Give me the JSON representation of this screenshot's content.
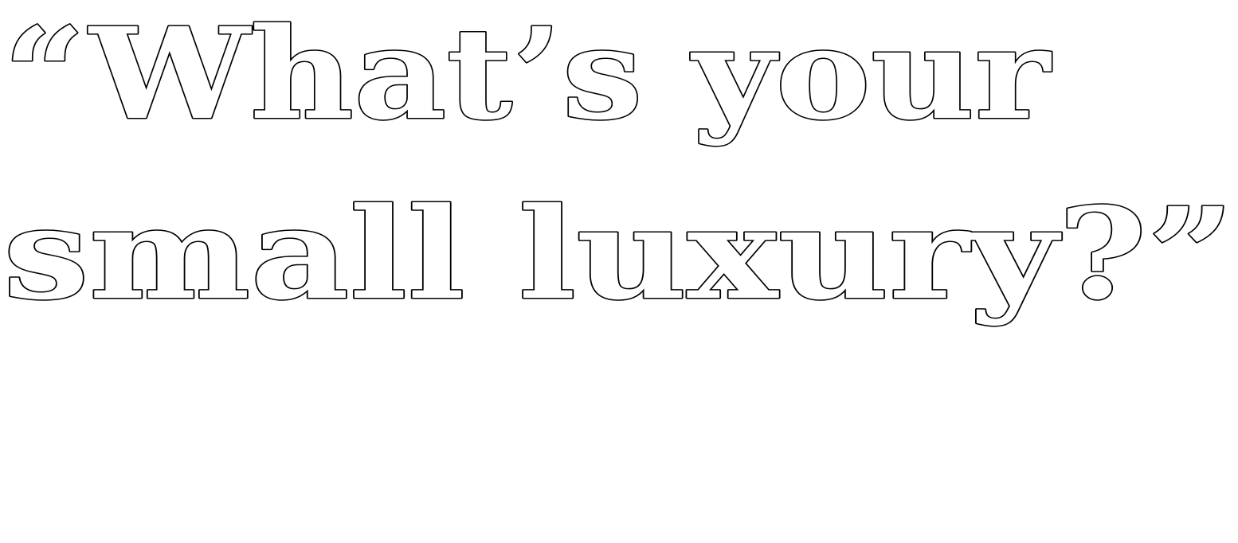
{
  "headline": {
    "line1": "“What’s your",
    "line2": "small luxury?”"
  },
  "colors": {
    "background": "#ffffff",
    "text_fill": "#ffffff",
    "text_stroke": "#000000"
  }
}
